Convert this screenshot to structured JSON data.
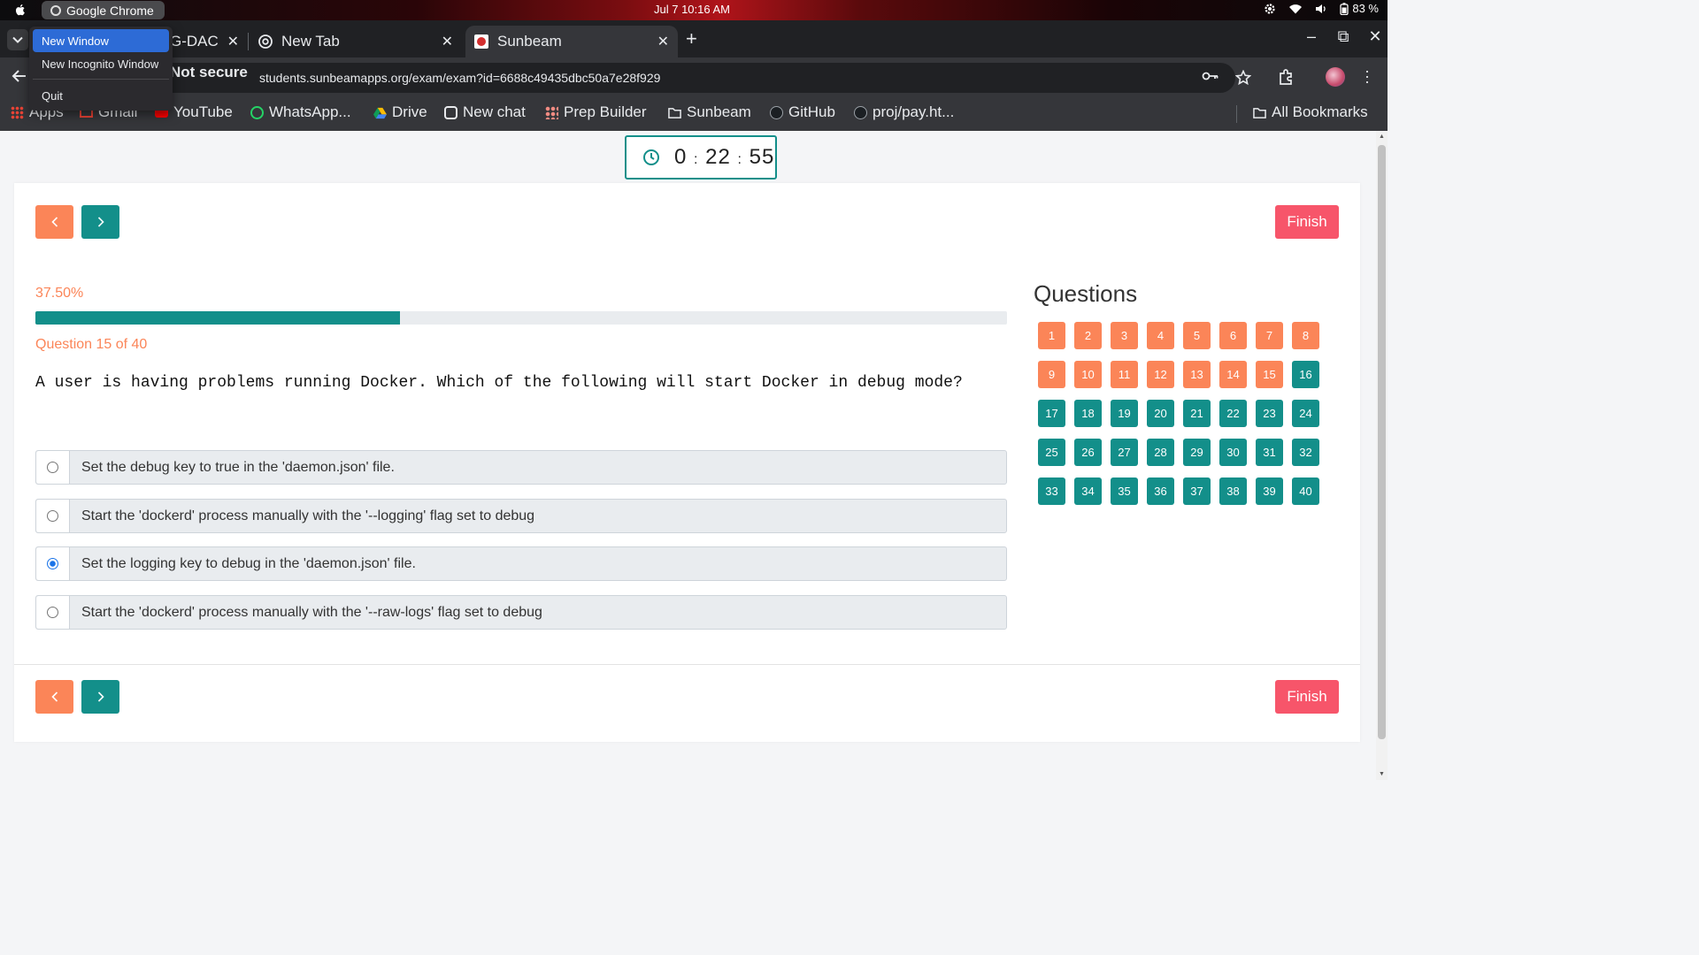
{
  "os_bar": {
    "app_name": "Google Chrome",
    "clock": "Jul 7  10:16 AM",
    "battery": "83 %"
  },
  "app_menu": {
    "items": [
      "New Window",
      "New Incognito Window",
      "Quit"
    ]
  },
  "tabs": [
    {
      "label": "G-DAC"
    },
    {
      "label": "New Tab"
    },
    {
      "label": "Sunbeam"
    }
  ],
  "toolbar": {
    "security_label": "Not secure",
    "url": "students.sunbeamapps.org/exam/exam?id=6688c49435dbc50a7e28f929"
  },
  "bookmarks": [
    {
      "label": "Apps",
      "icon": "apps-grid-icon"
    },
    {
      "label": "Gmail",
      "icon": "gmail-icon"
    },
    {
      "label": "YouTube",
      "icon": "youtube-icon"
    },
    {
      "label": "WhatsApp...",
      "icon": "whatsapp-icon"
    },
    {
      "label": "Drive",
      "icon": "drive-icon"
    },
    {
      "label": "New chat",
      "icon": "chatgpt-icon"
    },
    {
      "label": "Prep Builder",
      "icon": "prep-builder-icon"
    },
    {
      "label": "Sunbeam",
      "icon": "folder-icon"
    },
    {
      "label": "GitHub",
      "icon": "github-icon"
    },
    {
      "label": "proj/pay.ht...",
      "icon": "github-icon"
    }
  ],
  "all_bookmarks": "All Bookmarks",
  "timer": {
    "hours": "0",
    "minutes": "22",
    "seconds": "55"
  },
  "exam": {
    "finish_label": "Finish",
    "progress_text": "37.50%",
    "progress_fraction": 0.375,
    "question_counter": "Question 15 of 40",
    "question_text": "A user is having problems running Docker. Which of the following will start Docker in debug mode?",
    "options": [
      {
        "text": "Set the debug key to true in the 'daemon.json' file.",
        "selected": false
      },
      {
        "text": "Start the 'dockerd' process manually with the '--logging' flag set to debug",
        "selected": false
      },
      {
        "text": "Set the logging key to debug in the 'daemon.json' file.",
        "selected": true
      },
      {
        "text": "Start the 'dockerd' process manually with the '--raw-logs' flag set to debug",
        "selected": false
      }
    ]
  },
  "questions_panel": {
    "heading": "Questions",
    "answered_upto": 15,
    "numbers": [
      "1",
      "2",
      "3",
      "4",
      "5",
      "6",
      "7",
      "8",
      "9",
      "10",
      "11",
      "12",
      "13",
      "14",
      "15",
      "16",
      "17",
      "18",
      "19",
      "20",
      "21",
      "22",
      "23",
      "24",
      "25",
      "26",
      "27",
      "28",
      "29",
      "30",
      "31",
      "32",
      "33",
      "34",
      "35",
      "36",
      "37",
      "38",
      "39",
      "40"
    ]
  },
  "colors": {
    "accent_teal": "#138f8a",
    "accent_orange": "#fb8558",
    "finish_red": "#f7556a"
  }
}
